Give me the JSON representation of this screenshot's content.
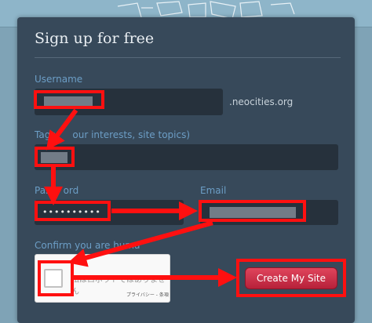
{
  "form": {
    "title": "Sign up for free",
    "username_label": "Username",
    "username_suffix": ".neocities.org",
    "tags_label_visible": "Tags",
    "tags_label_rest": "our interests, site topics)",
    "password_label": "Pass",
    "password_label_rest": "ord",
    "password_value": "••••••••••",
    "email_label": "Email",
    "confirm_label": "Confirm you are huma",
    "create_button": "Create My Site"
  },
  "captcha": {
    "text": "私はロボットではありません",
    "footer": "プライバシー - 条項"
  },
  "colors": {
    "panel": "#37495a",
    "input": "#26313c",
    "label": "#6c9ec6",
    "annotation": "#ff1010",
    "button": "#c52c44"
  }
}
